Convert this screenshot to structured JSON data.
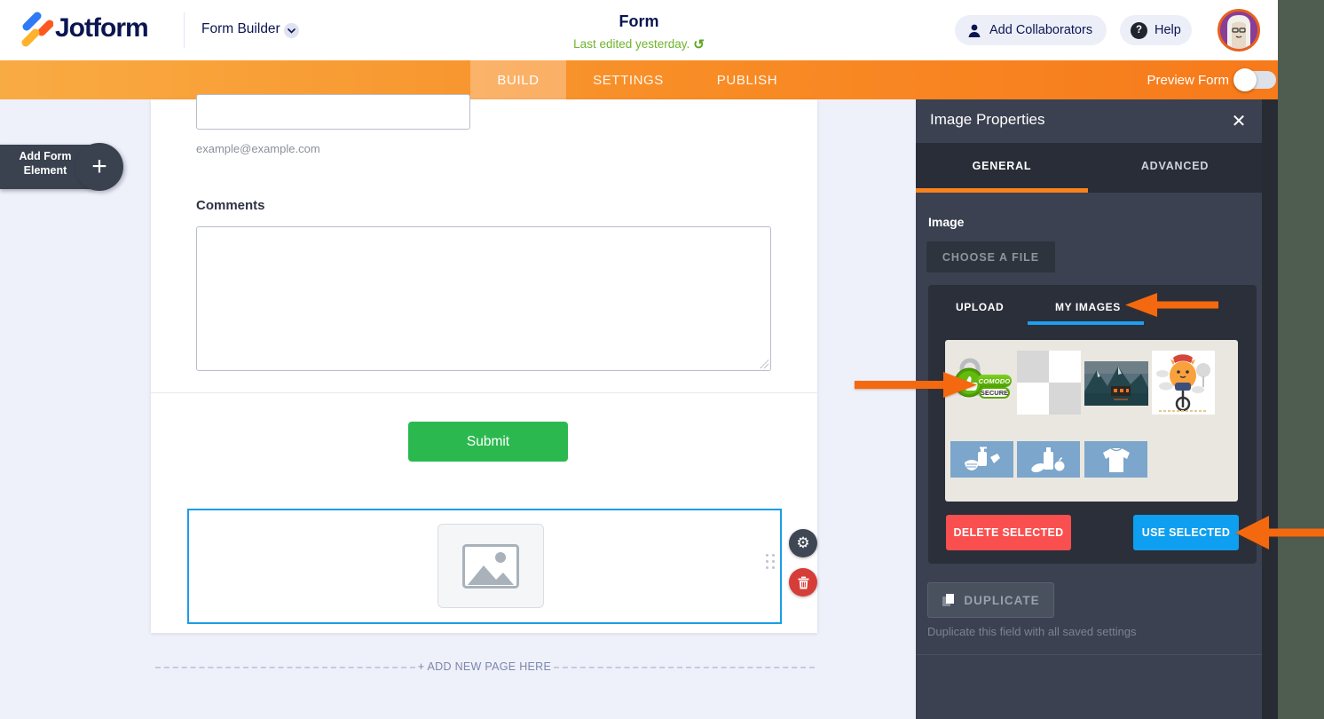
{
  "header": {
    "brand": "Jotform",
    "product": "Form Builder",
    "title": "Form",
    "last_edited": "Last edited yesterday.",
    "undo_icon": "↺",
    "add_collaborators": "Add Collaborators",
    "help": "Help",
    "help_icon": "?"
  },
  "navbar": {
    "build": "BUILD",
    "settings": "SETTINGS",
    "publish": "PUBLISH",
    "preview": "Preview Form"
  },
  "sidebar": {
    "add_form": "Add Form",
    "element": "Element",
    "plus": "+"
  },
  "form": {
    "email_hint": "example@example.com",
    "comments_label": "Comments",
    "submit": "Submit",
    "add_page": "+ ADD NEW PAGE HERE"
  },
  "controls": {
    "gear_icon": "⚙",
    "close_icon": "✕"
  },
  "panel": {
    "title": "Image Properties",
    "tab_general": "GENERAL",
    "tab_advanced": "ADVANCED",
    "image_label": "Image",
    "choose_file": "CHOOSE A FILE",
    "tab_upload": "UPLOAD",
    "tab_my_images": "MY IMAGES",
    "delete_selected": "DELETE SELECTED",
    "use_selected": "USE SELECTED",
    "duplicate": "DUPLICATE",
    "duplicate_hint": "Duplicate this field with all saved settings"
  },
  "badge": {
    "comodo": "COMODO",
    "secure": "SECURE"
  },
  "colors": {
    "accent_orange": "#f8821b",
    "tab_blue": "#1e9ef0",
    "submit_green": "#2bb94f",
    "delete_red": "#fa4f4f",
    "use_blue": "#0f9ff0",
    "selection_blue": "#1a9de9",
    "arrow_orange": "#f4690f",
    "navy": "#0a1551"
  }
}
